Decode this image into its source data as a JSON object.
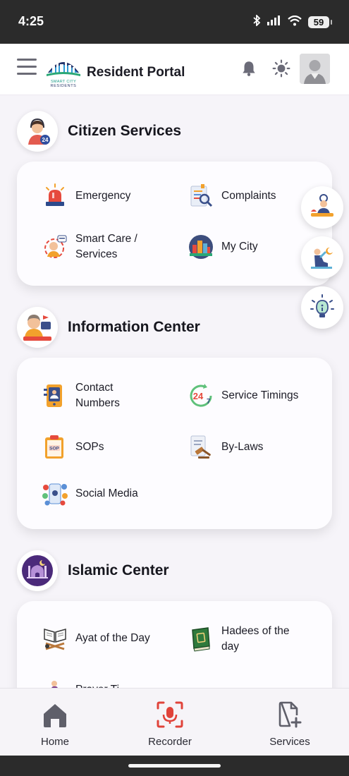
{
  "status": {
    "time": "4:25",
    "battery": "59"
  },
  "header": {
    "title": "Resident Portal",
    "logo_line1": "SMART CITY",
    "logo_line2": "RESIDENTS"
  },
  "sections": {
    "citizen": {
      "title": "Citizen Services",
      "items": [
        {
          "label": "Emergency",
          "icon": "siren-icon"
        },
        {
          "label": "Complaints",
          "icon": "complaint-report-icon"
        },
        {
          "label": "Smart Care / Services",
          "icon": "customer-care-icon"
        },
        {
          "label": "My City",
          "icon": "city-icon"
        }
      ]
    },
    "info": {
      "title": "Information Center",
      "items": [
        {
          "label": "Contact Numbers",
          "icon": "phone-book-icon"
        },
        {
          "label": "Service Timings",
          "icon": "24-7-icon"
        },
        {
          "label": "SOPs",
          "icon": "sop-clipboard-icon"
        },
        {
          "label": "By-Laws",
          "icon": "gavel-document-icon"
        },
        {
          "label": "Social Media",
          "icon": "social-media-icon"
        }
      ]
    },
    "islamic": {
      "title": "Islamic Center",
      "items": [
        {
          "label": "Ayat of the Day",
          "icon": "quran-stand-icon"
        },
        {
          "label": "Hadees of the day",
          "icon": "book-icon"
        },
        {
          "label": "Prayer Ti...",
          "icon": "prayer-icon"
        }
      ]
    }
  },
  "floating": [
    {
      "icon": "chef-icon"
    },
    {
      "icon": "prayer-person-icon"
    },
    {
      "icon": "lightbulb-icon"
    }
  ],
  "bottom_nav": [
    {
      "label": "Home",
      "icon": "home-icon"
    },
    {
      "label": "Recorder",
      "icon": "microphone-icon"
    },
    {
      "label": "Services",
      "icon": "document-add-icon"
    }
  ],
  "colors": {
    "accent_red": "#e0433a",
    "icon_gray": "#5f5f6a",
    "card_bg": "#fdfcff"
  }
}
